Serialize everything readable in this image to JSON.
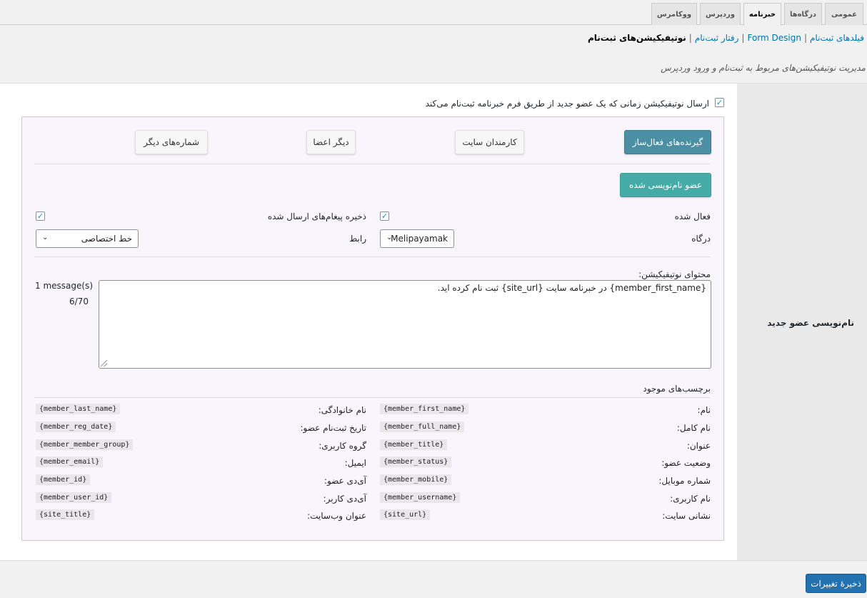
{
  "tabs": [
    {
      "label": "عمومی"
    },
    {
      "label": "درگاه‌ها"
    },
    {
      "label": "خبرنامه"
    },
    {
      "label": "وردپرس"
    },
    {
      "label": "ووکامرس"
    }
  ],
  "subnav": {
    "link1": "فیلدهای ثبت‌نام",
    "sep": "|",
    "link2": "Form Design",
    "link3": "رفتار ثبت‌نام",
    "current": "نوتیفیکیشن‌های ثبت‌نام"
  },
  "description": "مدیریت نوتیفیکیشن‌های مربوط به ثبت‌نام و ورود وردپرس",
  "row_label": "نام‌نویسی عضو جدید",
  "enable_checkbox_label": "ارسال نوتیفیکیشن زمانی که یک عضو جدید از طریق فرم خبرنامه ثبت‌نام می‌کند",
  "check_mark": "✓",
  "recipient_buttons": {
    "active_recipients": "گیرنده‌های فعال‌ساز",
    "site_staff": "کارمندان سایت",
    "other_members": "دیگر اعضا",
    "other_numbers": "شماره‌های دیگر"
  },
  "member_button": "عضو نام‌نویسی شده",
  "fields": {
    "active_label": "فعال شده",
    "save_messages_label": "ذخیره پیغام‌های ارسال شده",
    "gateway_label": "درگاه",
    "gateway_value": "Melipayamak",
    "line_label": "رابط",
    "line_value": "خط اختصاصی",
    "chevron_icon": "chevron-down-icon",
    "chevron": "⌄"
  },
  "content": {
    "label": "محتوای نوتیفیکیشن:",
    "message_text": "{member_first_name} در خبرنامه سایت {site_url} ثبت نام کرده اید.",
    "message_count": "1 message(s)",
    "char_count": "6/70"
  },
  "tags": {
    "heading": "برچسب‌های موجود",
    "right": [
      {
        "label": "نام:",
        "code": "{member_first_name}"
      },
      {
        "label": "نام کامل:",
        "code": "{member_full_name}"
      },
      {
        "label": "عنوان:",
        "code": "{member_title}"
      },
      {
        "label": "وضعیت عضو:",
        "code": "{member_status}"
      },
      {
        "label": "شماره موبایل:",
        "code": "{member_mobile}"
      },
      {
        "label": "نام کاربری:",
        "code": "{member_username}"
      },
      {
        "label": "نشانی سایت:",
        "code": "{site_url}"
      }
    ],
    "left": [
      {
        "label": "نام خانوادگی:",
        "code": "{member_last_name}"
      },
      {
        "label": "تاریخ ثبت‌نام عضو:",
        "code": "{member_reg_date}"
      },
      {
        "label": "گروه کاربری:",
        "code": "{member_member_group}"
      },
      {
        "label": "ایمیل:",
        "code": "{member_email}"
      },
      {
        "label": "آی‌دی عضو:",
        "code": "{member_id}"
      },
      {
        "label": "آی‌دی کاربر:",
        "code": "{member_user_id}"
      },
      {
        "label": "عنوان وب‌سایت:",
        "code": "{site_title}"
      }
    ]
  },
  "save_button": "ذخیرهٔ تغییرات",
  "colors": {
    "primary_button": "#4a8fa3",
    "member_button": "#45aba7",
    "save_button": "#2271b1",
    "link": "#0073aa"
  }
}
